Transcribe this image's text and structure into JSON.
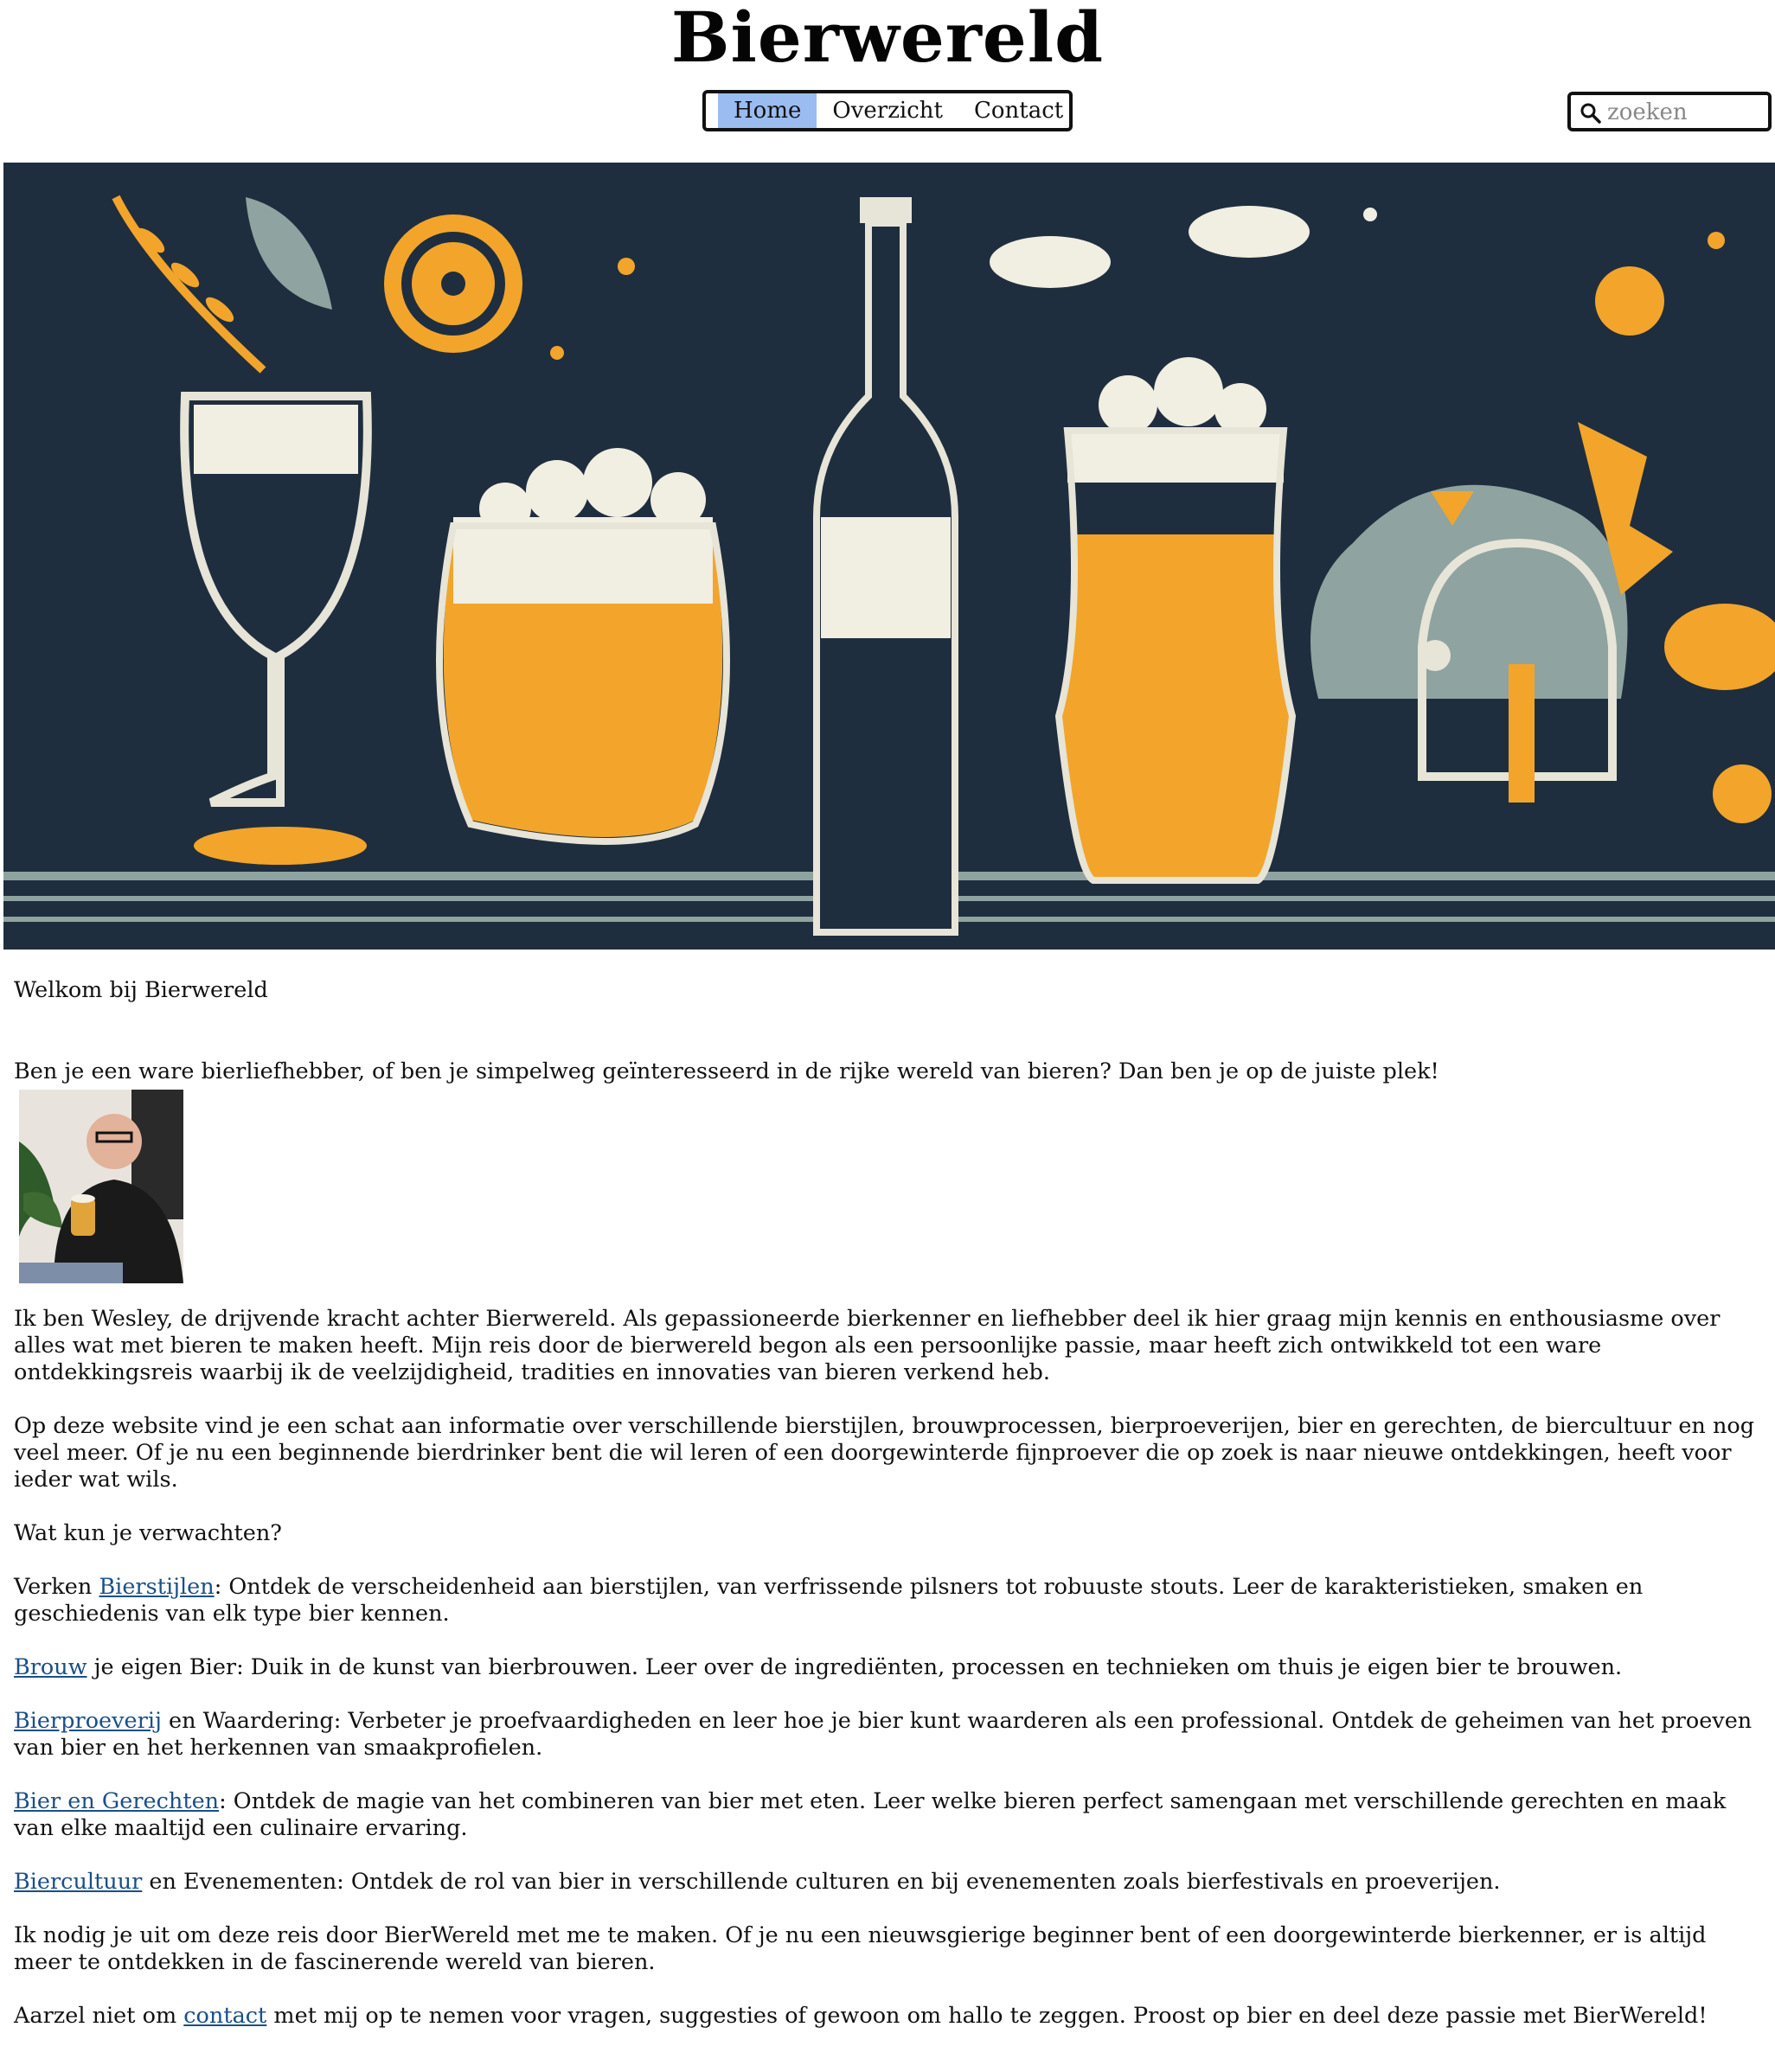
{
  "header": {
    "site_title": "Bierwereld",
    "nav": [
      {
        "label": "Home",
        "active": true
      },
      {
        "label": "Overzicht",
        "active": false
      },
      {
        "label": "Contact",
        "active": false
      }
    ],
    "search": {
      "placeholder": "zoeken",
      "value": ""
    }
  },
  "hero": {
    "icon": "beer-illustration-banner"
  },
  "content": {
    "welcome": "Welkom bij Bierwereld",
    "intro": "Ben je een ware bierliefhebber, of ben je simpelweg geïnteresseerd in de rijke wereld van bieren? Dan ben je op de juiste plek!",
    "about": "Ik ben Wesley, de drijvende kracht achter Bierwereld. Als gepassioneerde bierkenner en liefhebber deel ik hier graag mijn kennis en enthousiasme over alles wat met bieren te maken heeft. Mijn reis door de bierwereld begon als een persoonlijke passie, maar heeft zich ontwikkeld tot een ware ontdekkingsreis waarbij ik de veelzijdigheid, tradities en innovaties van bieren verkend heb.",
    "website": "Op deze website vind je een schat aan informatie over verschillende bierstijlen, brouwprocessen, bierproeverijen, bier en gerechten, de biercultuur en nog veel meer. Of je nu een beginnende bierdrinker bent die wil leren of een doorgewinterde fijnproever die op zoek is naar nieuwe ontdekkingen,  heeft voor ieder wat wils.",
    "expect": "Wat kun je verwachten?",
    "items": [
      {
        "prefix": "Verken ",
        "link": "Bierstijlen",
        "text": ": Ontdek de verscheidenheid aan bierstijlen, van verfrissende pilsners tot robuuste stouts. Leer de karakteristieken, smaken en geschiedenis van elk type bier kennen."
      },
      {
        "prefix": "",
        "link": "Brouw",
        "text": " je eigen Bier: Duik in de kunst van bierbrouwen. Leer over de ingrediënten, processen en technieken om thuis je eigen bier te brouwen."
      },
      {
        "prefix": "",
        "link": "Bierproeverij",
        "text": " en Waardering: Verbeter je proefvaardigheden en leer hoe je bier kunt waarderen als een professional. Ontdek de geheimen van het proeven van bier en het herkennen van smaakprofielen."
      },
      {
        "prefix": "",
        "link": "Bier en Gerechten",
        "text": ": Ontdek de magie van het combineren van bier met eten. Leer welke bieren perfect samengaan met verschillende gerechten en maak van elke maaltijd een culinaire ervaring."
      },
      {
        "prefix": "",
        "link": "Biercultuur",
        "text": " en Evenementen: Ontdek de rol van bier in verschillende culturen en bij evenementen zoals bierfestivals en proeverijen."
      }
    ],
    "invite": "Ik nodig je uit om deze reis door BierWereld met me te maken. Of je nu een nieuwsgierige beginner bent of een doorgewinterde bierkenner, er is altijd meer te ontdekken in de fascinerende wereld van bieren.",
    "closing": {
      "before": "Aarzel niet om ",
      "link": "contact",
      "after": " met mij op te nemen voor vragen, suggesties of gewoon om hallo te zeggen. Proost op bier en deel deze passie met BierWereld!"
    }
  },
  "colors": {
    "accent": "#9bbcf0",
    "link": "#1a4f88",
    "hero_bg": "#1f2e3e",
    "beer": "#f2a52a"
  }
}
